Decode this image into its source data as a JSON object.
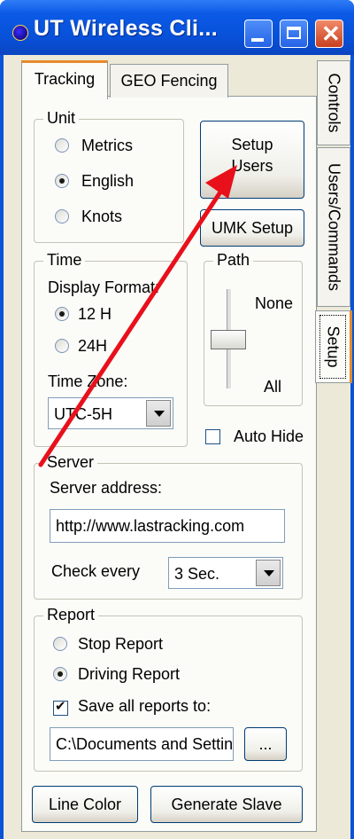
{
  "window": {
    "title": "UT Wireless Cli..."
  },
  "tabs": {
    "tracking": "Tracking",
    "geo_fencing": "GEO Fencing"
  },
  "side_tabs": {
    "controls": "Controls",
    "users_commands": "Users/Commands",
    "setup": "Setup"
  },
  "unit": {
    "legend": "Unit",
    "options": [
      "Metrics",
      "English",
      "Knots"
    ],
    "selected": "English"
  },
  "buttons": {
    "setup_users": "Setup Users",
    "umk_setup": "UMK Setup",
    "line_color": "Line Color",
    "generate_slave": "Generate Slave",
    "browse": "..."
  },
  "time": {
    "legend": "Time",
    "display_format_label": "Display Format:",
    "options": [
      "12 H",
      "24H"
    ],
    "selected": "12 H",
    "time_zone_label": "Time Zone:",
    "time_zone_value": "UTC-5H"
  },
  "path": {
    "legend": "Path",
    "top_label": "None",
    "bottom_label": "All"
  },
  "auto_hide": {
    "label": "Auto Hide",
    "checked": false
  },
  "server": {
    "legend": "Server",
    "address_label": "Server address:",
    "address_value": "http://www.lastracking.com",
    "check_every_label": "Check every",
    "check_every_value": "3 Sec."
  },
  "report": {
    "legend": "Report",
    "options": [
      "Stop Report",
      "Driving Report"
    ],
    "selected": "Driving Report",
    "save_label": "Save all reports to:",
    "save_checked": true,
    "path_value": "C:\\Documents and Settings"
  },
  "annotation_color": "#e8101a"
}
